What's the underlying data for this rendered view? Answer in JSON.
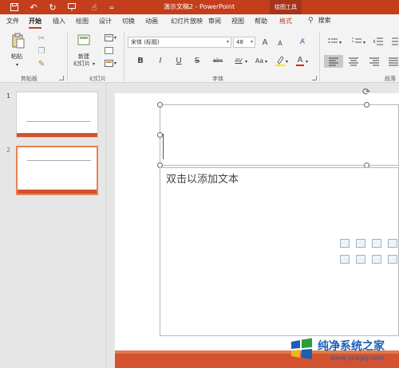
{
  "titlebar": {
    "title": "演示文稿2 - PowerPoint",
    "context_tab": "绘图工具",
    "quick_access": [
      "save-icon",
      "undo-icon",
      "redo-icon",
      "present-icon",
      "touch-mode-icon",
      "customize-icon"
    ],
    "colors": {
      "accent": "#c43e1c"
    }
  },
  "tabs": {
    "file": "文件",
    "home": "开始",
    "insert": "插入",
    "draw": "绘图",
    "design": "设计",
    "transitions": "切换",
    "animations": "动画",
    "slideshow": "幻灯片放映",
    "review": "审阅",
    "view": "视图",
    "help": "帮助",
    "format": "格式",
    "search": "搜索"
  },
  "ribbon": {
    "clipboard": {
      "paste": "粘贴",
      "label": "剪贴板"
    },
    "slides": {
      "new_slide": "新建",
      "new_slide2": "幻灯片",
      "label": "幻灯片"
    },
    "font": {
      "font_name": "宋体 (标题)",
      "font_size": "48",
      "bold": "B",
      "italic": "I",
      "underline": "U",
      "strike": "S",
      "shadow": "abc",
      "spacing": "AV",
      "case": "Aa",
      "color": "A",
      "grow": "A",
      "shrink": "A",
      "label": "字体"
    },
    "paragraph": {
      "label": "段落"
    }
  },
  "thumbnails": [
    {
      "number": "1"
    },
    {
      "number": "2"
    }
  ],
  "slide": {
    "body_placeholder": "双击以添加文本"
  },
  "watermark": {
    "text": "纯净系统之家",
    "url": "www.ycwjzy.com"
  }
}
